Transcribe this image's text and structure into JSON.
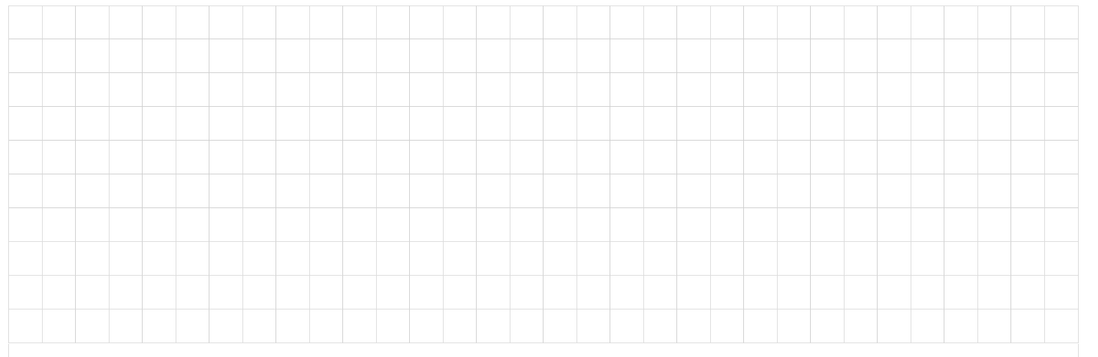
{
  "grid": {
    "rows": 10,
    "columns": 32,
    "cells": []
  }
}
